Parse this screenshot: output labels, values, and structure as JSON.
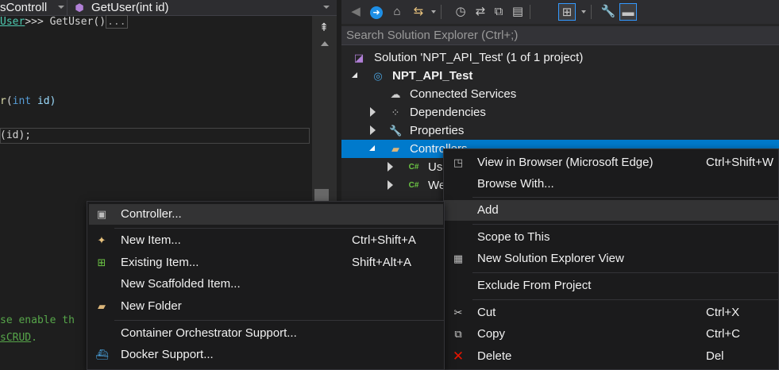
{
  "editor": {
    "nav_left": "sControll",
    "nav_method": "GetUser(int id)",
    "code": {
      "line1_type": "User",
      "line1_rest": ">>> GetUser()",
      "line1_fold": "...",
      "line2_method": "r",
      "line2_kw": "int",
      "line2_param": " id)",
      "line3_rest": "(id);",
      "line4_comment": "se enable th",
      "line5_link": "sCRUD",
      "line5_rest": "."
    }
  },
  "solution_explorer": {
    "search_placeholder": "Search Solution Explorer (Ctrl+;)",
    "tree": {
      "solution": "Solution 'NPT_API_Test' (1 of 1 project)",
      "project": "NPT_API_Test",
      "connected_services": "Connected Services",
      "dependencies": "Dependencies",
      "properties": "Properties",
      "controllers": "Controllers",
      "child1": "Us",
      "child2": "We"
    }
  },
  "context_menu": {
    "items": {
      "view_in_browser": {
        "label": "View in Browser (Microsoft Edge)",
        "shortcut": "Ctrl+Shift+W"
      },
      "browse_with": {
        "label": "Browse With..."
      },
      "add": {
        "label": "Add"
      },
      "scope_to_this": {
        "label": "Scope to This"
      },
      "new_se_view": {
        "label": "New Solution Explorer View"
      },
      "exclude": {
        "label": "Exclude From Project"
      },
      "cut": {
        "label": "Cut",
        "shortcut": "Ctrl+X"
      },
      "copy": {
        "label": "Copy",
        "shortcut": "Ctrl+C"
      },
      "delete": {
        "label": "Delete",
        "shortcut": "Del"
      }
    }
  },
  "add_submenu": {
    "items": {
      "controller": {
        "label": "Controller..."
      },
      "new_item": {
        "label": "New Item...",
        "shortcut": "Ctrl+Shift+A"
      },
      "existing_item": {
        "label": "Existing Item...",
        "shortcut": "Shift+Alt+A"
      },
      "new_scaffolded": {
        "label": "New Scaffolded Item..."
      },
      "new_folder": {
        "label": "New Folder"
      },
      "container_orch": {
        "label": "Container Orchestrator Support..."
      },
      "docker_support": {
        "label": "Docker Support..."
      }
    }
  },
  "colors": {
    "background": "#1e1e1e",
    "panel": "#252526",
    "selection": "#007acc",
    "menu": "#1b1b1c",
    "keyword": "#569cd6",
    "type": "#4ec9b0",
    "method": "#dcdcaa",
    "comment": "#57a64a",
    "delete_icon": "#e51400"
  },
  "icons": [
    "back-icon",
    "forward-icon",
    "home-icon",
    "sync-icon",
    "history-icon",
    "refresh-icon",
    "collapse-icon",
    "copy-icon",
    "view-icon",
    "wrench-icon",
    "pin-icon"
  ]
}
